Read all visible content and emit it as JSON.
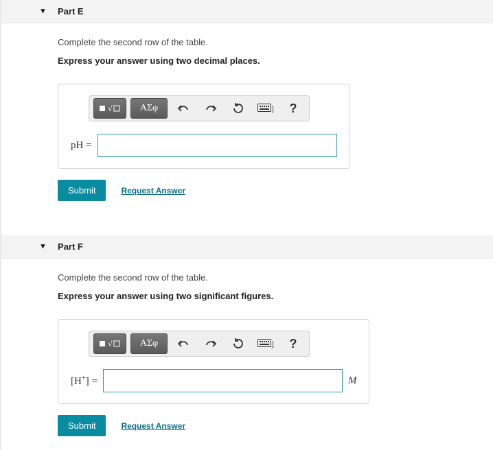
{
  "parts": [
    {
      "id": "E",
      "title": "Part E",
      "instruction": "Complete the second row of the table.",
      "express": "Express your answer using two decimal places.",
      "label_html": "pH =",
      "unit": "",
      "toolbar": {
        "template": "T1",
        "math": "math",
        "greek": "ΑΣφ",
        "undo": "undo",
        "redo": "redo",
        "reset": "reset",
        "keyboard": "kbd",
        "help": "?"
      },
      "submit": "Submit",
      "request": "Request Answer"
    },
    {
      "id": "F",
      "title": "Part F",
      "instruction": "Complete the second row of the table.",
      "express": "Express your answer using two significant figures.",
      "label_html": "[H+] =",
      "unit": "M",
      "toolbar": {
        "template": "T1",
        "math": "math",
        "greek": "ΑΣφ",
        "undo": "undo",
        "redo": "redo",
        "reset": "reset",
        "keyboard": "kbd",
        "help": "?"
      },
      "submit": "Submit",
      "request": "Request Answer"
    }
  ]
}
